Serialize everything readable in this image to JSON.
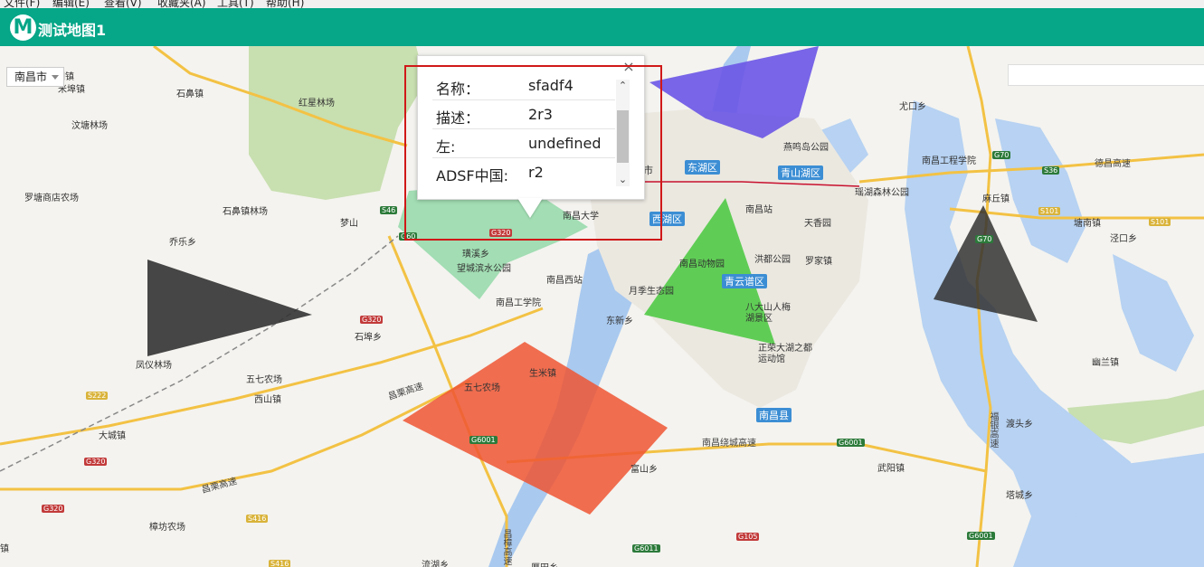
{
  "menubar": {
    "items": [
      "文件(F)",
      "编辑(E)",
      "查看(V)",
      "收藏夹(A)",
      "工具(T)",
      "帮助(H)"
    ]
  },
  "titlebar": {
    "logo_letter": "M",
    "title": "测试地图1",
    "bg_color": "#06a688"
  },
  "map": {
    "city_select": "南昌市",
    "popup": {
      "close": "×",
      "rows": [
        {
          "key": "名称：",
          "value": "sfadf4"
        },
        {
          "key": "描述：",
          "value": "2r3"
        },
        {
          "key": "左:",
          "value": "undefined"
        },
        {
          "key": "ADSF中国:",
          "value": "r2"
        }
      ],
      "scroll_up": "⌃",
      "scroll_down": "⌄"
    },
    "districts": [
      "市",
      "东湖区",
      "青山湖区",
      "西湖区",
      "青云谱区",
      "南昌县"
    ],
    "places": [
      "洲镇",
      "米埠镇",
      "石鼻镇",
      "红星林场",
      "汶塘林场",
      "罗塘商店农场",
      "石鼻镇林场",
      "乔乐乡",
      "梦山",
      "璜溪乡",
      "望城滨水公园",
      "南昌大学",
      "南昌西站",
      "南昌工学院",
      "月季生态园",
      "南昌动物园",
      "南昌站",
      "天香园",
      "洪都公园",
      "罗家镇",
      "八大山人梅湖景区",
      "正荣大湖之都运动馆",
      "东新乡",
      "石埠乡",
      "凤仪林场",
      "五七农场",
      "西山镇",
      "大城镇",
      "樟坊农场",
      "五七农场",
      "生米镇",
      "富山乡",
      "流湖乡",
      "厚田乡",
      "尤口乡",
      "燕鸣岛公园",
      "南昌工程学院",
      "瑶湖森林公园",
      "麻丘镇",
      "德昌高速",
      "塘南镇",
      "泾口乡",
      "幽兰镇",
      "渡头乡",
      "武阳镇",
      "塔城乡",
      "镇"
    ],
    "roads": [
      "昌栗高速",
      "昌栗高速",
      "南昌绕城高速",
      "福银高速",
      "昌樟高速"
    ],
    "shields": [
      "S46",
      "G60",
      "G320",
      "G320",
      "G320",
      "G320",
      "S222",
      "S416",
      "S416",
      "G6001",
      "G6001",
      "G6011",
      "G105",
      "G70",
      "G70",
      "S36",
      "S101",
      "S101",
      "G6001"
    ],
    "polygons": [
      {
        "name": "purple-polygon",
        "color": "#6a55e6"
      },
      {
        "name": "green-light-polygon",
        "color": "#7fd39a"
      },
      {
        "name": "green-polygon",
        "color": "#46c83c"
      },
      {
        "name": "dark-triangle-left",
        "color": "#333333"
      },
      {
        "name": "dark-triangle-right",
        "color": "#333333"
      },
      {
        "name": "red-polygon",
        "color": "#ee5533"
      }
    ]
  }
}
